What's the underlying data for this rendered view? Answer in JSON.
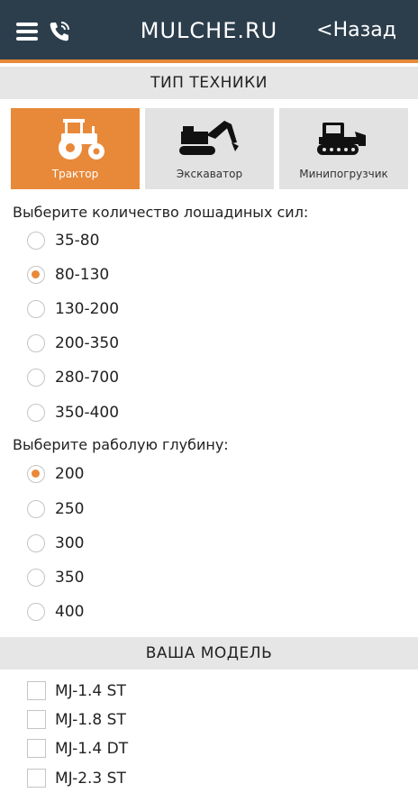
{
  "header": {
    "title": "MULCHE.RU",
    "back_label": "<Назад"
  },
  "colors": {
    "header_bg": "#2c3e4c",
    "accent": "#e8893a",
    "section_bg": "#e6e6e6",
    "tab_bg": "#e2e2e2"
  },
  "equipment": {
    "section_title": "ТИП ТЕХНИКИ",
    "tabs": [
      {
        "label": "Трактор",
        "icon": "tractor-icon",
        "selected": true
      },
      {
        "label": "Экскаватор",
        "icon": "excavator-icon",
        "selected": false
      },
      {
        "label": "Минипогрузчик",
        "icon": "skid-steer-icon",
        "selected": false
      }
    ]
  },
  "horsepower": {
    "label": "Выберите количество лошадиных сил:",
    "options": [
      "35-80",
      "80-130",
      "130-200",
      "200-350",
      "280-700",
      "350-400"
    ],
    "selected": "80-130"
  },
  "depth": {
    "label": "Выберите раболую глубину:",
    "options": [
      "200",
      "250",
      "300",
      "350",
      "400"
    ],
    "selected": "200"
  },
  "models": {
    "section_title": "ВАША МОДЕЛЬ",
    "items": [
      "MJ-1.4 ST",
      "MJ-1.8 ST",
      "MJ-1.4 DT",
      "MJ-2.3 ST"
    ]
  }
}
